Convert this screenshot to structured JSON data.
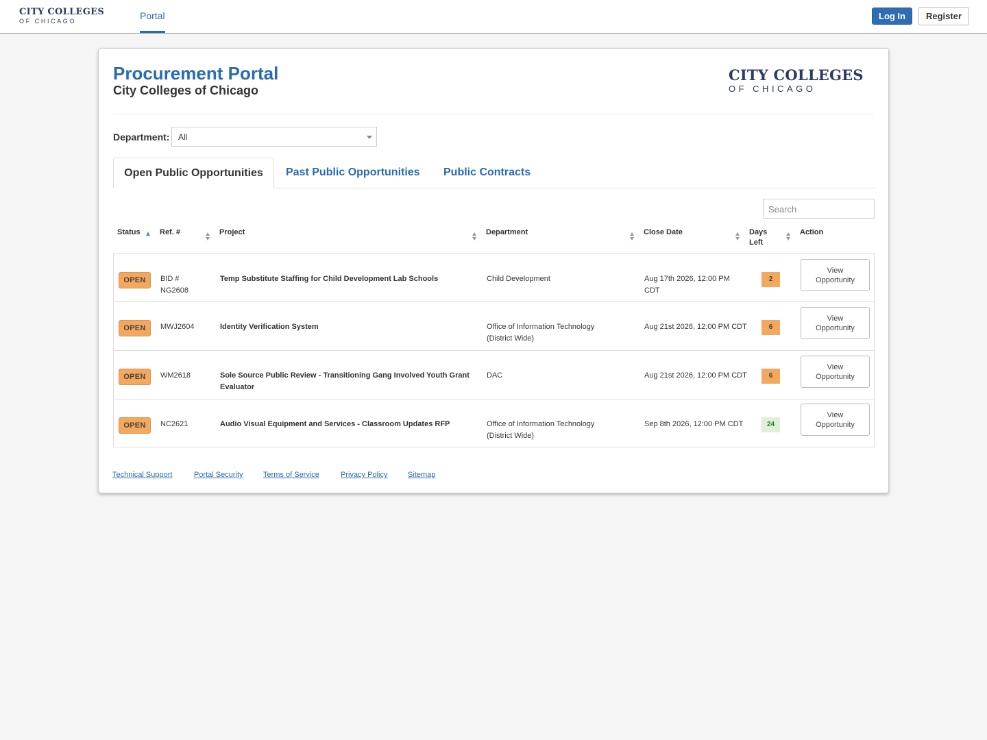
{
  "topnav": {
    "brand_line1": "CITY COLLEGES",
    "brand_line2": "OF CHICAGO",
    "portal_label": "Portal",
    "login_label": "Log In",
    "register_label": "Register"
  },
  "page": {
    "title": "Procurement Portal",
    "subtitle": "City Colleges of Chicago",
    "logo_line1": "CITY COLLEGES",
    "logo_line2": "OF CHICAGO"
  },
  "filter": {
    "department_label": "Department:",
    "department_value": "All"
  },
  "tabs": [
    {
      "label": "Open Public Opportunities",
      "active": true
    },
    {
      "label": "Past Public Opportunities",
      "active": false
    },
    {
      "label": "Public Contracts",
      "active": false
    }
  ],
  "search": {
    "placeholder": "Search"
  },
  "table": {
    "headers": {
      "status": "Status",
      "ref": "Ref. #",
      "project": "Project",
      "department": "Department",
      "close_date": "Close Date",
      "days_left": "Days Left",
      "action": "Action"
    },
    "rows": [
      {
        "status": "OPEN",
        "ref": "BID # NG2608",
        "project": "Temp Substitute Staffing for Child Development Lab Schools",
        "department": "Child Development",
        "close_date": "Aug 17th 2026, 12:00 PM CDT",
        "days_left": "2",
        "days_color": "#f3a85e",
        "action": "View Opportunity"
      },
      {
        "status": "OPEN",
        "ref": "MWJ2604",
        "project": "Identity Verification System",
        "department": "Office of Information Technology (District Wide)",
        "close_date": "Aug 21st 2026, 12:00 PM CDT",
        "days_left": "6",
        "days_color": "#f3a85e",
        "action": "View Opportunity"
      },
      {
        "status": "OPEN",
        "ref": "WM2618",
        "project": "Sole Source Public Review - Transitioning Gang Involved Youth Grant Evaluator",
        "department": "DAC",
        "close_date": "Aug 21st 2026, 12:00 PM CDT",
        "days_left": "6",
        "days_color": "#f3a85e",
        "action": "View Opportunity"
      },
      {
        "status": "OPEN",
        "ref": "NC2621",
        "project": "Audio Visual Equipment and Services - Classroom Updates RFP",
        "department": "Office of Information Technology (District Wide)",
        "close_date": "Sep 8th 2026, 12:00 PM CDT",
        "days_left": "24",
        "days_color": "#dff0d8",
        "action": "View Opportunity"
      }
    ]
  },
  "footer": {
    "links": [
      "Technical Support",
      "Portal Security",
      "Terms of Service",
      "Privacy Policy",
      "Sitemap"
    ]
  },
  "colors": {
    "accent": "#2a6bb0",
    "brand_navy": "#2b3a67",
    "open_badge": "#f3a85e",
    "days_green": "#dff0d8"
  }
}
